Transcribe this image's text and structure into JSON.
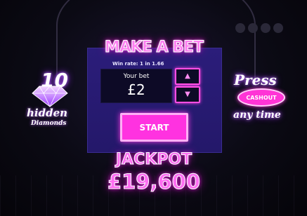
{
  "panel": {
    "title": "MAKE A BET",
    "win_rate": "Win rate: 1 in 1.66",
    "your_bet_label": "Your bet",
    "bet_value": "£2",
    "increase_icon": "arrow-up-icon",
    "decrease_icon": "arrow-down-icon",
    "start_label": "START"
  },
  "jackpot": {
    "label": "JACKPOT",
    "value": "£19,600"
  },
  "left_promo": {
    "number": "10",
    "line1": "hidden",
    "line2": "Diamonds",
    "icon": "diamond-icon"
  },
  "right_promo": {
    "line1": "Press",
    "badge": "CASHOUT",
    "line2": "any time"
  },
  "colors": {
    "panel_bg": "#2b1d7a",
    "accent_pink": "#ff32e0",
    "neon_text": "#ff6ef2",
    "bet_box_bg": "#0d0a26"
  }
}
